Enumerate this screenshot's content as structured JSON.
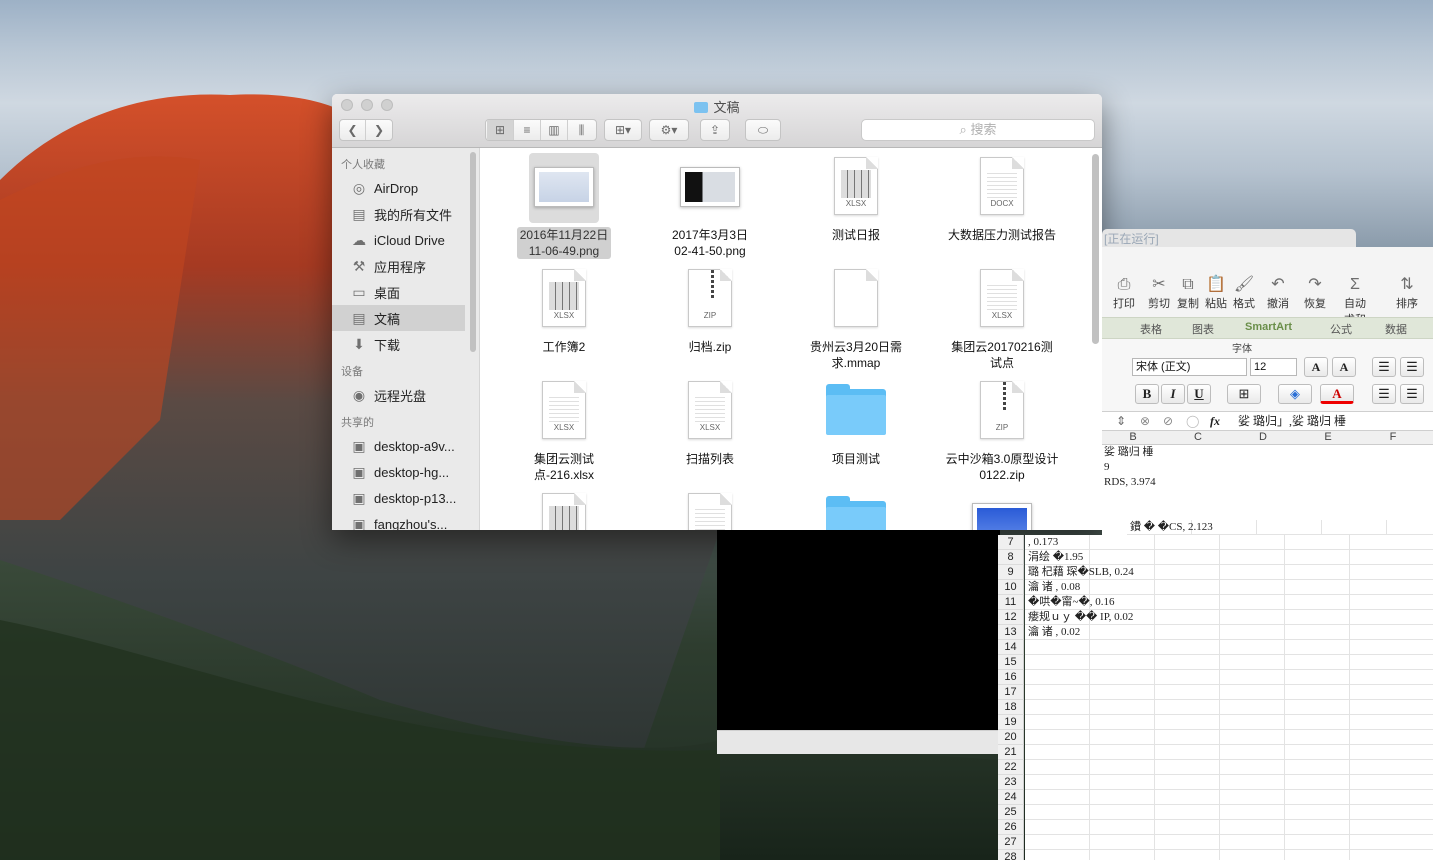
{
  "finder": {
    "title": "文稿",
    "search_placeholder": "搜索",
    "sidebar": {
      "favorites_header": "个人收藏",
      "favorites": [
        {
          "label": "AirDrop",
          "icon": "airdrop-icon"
        },
        {
          "label": "我的所有文件",
          "icon": "all-files-icon"
        },
        {
          "label": "iCloud Drive",
          "icon": "cloud-icon"
        },
        {
          "label": "应用程序",
          "icon": "applications-icon"
        },
        {
          "label": "桌面",
          "icon": "desktop-icon"
        },
        {
          "label": "文稿",
          "icon": "documents-icon",
          "selected": true
        },
        {
          "label": "下载",
          "icon": "downloads-icon"
        }
      ],
      "devices_header": "设备",
      "devices": [
        {
          "label": "远程光盘",
          "icon": "disc-icon"
        }
      ],
      "shared_header": "共享的",
      "shared": [
        {
          "label": "desktop-a9v...",
          "icon": "computer-icon"
        },
        {
          "label": "desktop-hg...",
          "icon": "computer-icon"
        },
        {
          "label": "desktop-p13...",
          "icon": "computer-icon"
        },
        {
          "label": "fangzhou's...",
          "icon": "computer-icon"
        }
      ]
    },
    "files": [
      {
        "line1": "2016年11月22日",
        "line2": "11-06-49.png",
        "kind": "image",
        "selected": true
      },
      {
        "line1": "2017年3月3日",
        "line2": "02-41-50.png",
        "kind": "image"
      },
      {
        "line1": "测试日报",
        "line2": "",
        "kind": "xlsx",
        "tag": "XLSX"
      },
      {
        "line1": "大数据压力测试报告",
        "line2": "",
        "kind": "doc",
        "tag": "DOCX"
      },
      {
        "line1": "工作簿2",
        "line2": "",
        "kind": "xlsx",
        "tag": "XLSX"
      },
      {
        "line1": "归档.zip",
        "line2": "",
        "kind": "zip",
        "tag": "ZIP"
      },
      {
        "line1": "贵州云3月20日需",
        "line2": "求.mmap",
        "kind": "blank"
      },
      {
        "line1": "集团云20170216测",
        "line2": "试点",
        "kind": "doc",
        "tag": "XLSX"
      },
      {
        "line1": "集团云测试",
        "line2": "点-216.xlsx",
        "kind": "doc",
        "tag": "XLSX"
      },
      {
        "line1": "扫描列表",
        "line2": "",
        "kind": "doc",
        "tag": "XLSX"
      },
      {
        "line1": "项目测试",
        "line2": "",
        "kind": "folder"
      },
      {
        "line1": "云中沙箱3.0原型设计",
        "line2": "0122.zip",
        "kind": "zip",
        "tag": "ZIP"
      },
      {
        "line1": "",
        "line2": "",
        "kind": "xlsx"
      },
      {
        "line1": "",
        "line2": "",
        "kind": "doc"
      },
      {
        "line1": "",
        "line2": "",
        "kind": "folder"
      },
      {
        "line1": "",
        "line2": "",
        "kind": "image"
      }
    ]
  },
  "excel": {
    "running_label": "[正在运行]",
    "ribbon_buttons": [
      "打印",
      "剪切",
      "复制",
      "粘贴",
      "格式",
      "撤消",
      "恢复",
      "自动求和",
      "排序"
    ],
    "ribbon_tabs": [
      "表格",
      "图表",
      "SmartArt",
      "公式",
      "数据"
    ],
    "font_group_label": "字体",
    "font_name": "宋体 (正文)",
    "font_size": "12",
    "formula": "娑   璐归」,娑   璐归      棰",
    "fx": "fx",
    "columns": [
      "B",
      "C",
      "D",
      "E",
      "F"
    ],
    "rows": [
      {
        "n": "",
        "text": "娑 璐归    棰"
      },
      {
        "n": "",
        "text": "9"
      },
      {
        "n": "",
        "text": "RDS, 3.974"
      },
      {
        "n": "",
        "text": ""
      },
      {
        "n": "",
        "text": ""
      },
      {
        "n": "",
        "text": "鐨     �    �CS, 2.123"
      },
      {
        "n": "7",
        "text": ", 0.173"
      },
      {
        "n": "8",
        "text": "涓绘   �1.95"
      },
      {
        "n": "9",
        "text": "璐   杞藉     琛�SLB, 0.24"
      },
      {
        "n": "10",
        "text": "瀹   诸   , 0.08"
      },
      {
        "n": "11",
        "text": "�哄�甯~�, 0.16"
      },
      {
        "n": "12",
        "text": "瘘规ｕｙ    ��  IP, 0.02"
      },
      {
        "n": "13",
        "text": "瀹   诸   , 0.02"
      },
      {
        "n": "14",
        "text": ""
      },
      {
        "n": "15",
        "text": ""
      },
      {
        "n": "16",
        "text": ""
      },
      {
        "n": "17",
        "text": ""
      },
      {
        "n": "18",
        "text": ""
      },
      {
        "n": "19",
        "text": ""
      },
      {
        "n": "20",
        "text": ""
      },
      {
        "n": "21",
        "text": ""
      },
      {
        "n": "22",
        "text": ""
      },
      {
        "n": "23",
        "text": ""
      },
      {
        "n": "24",
        "text": ""
      },
      {
        "n": "25",
        "text": ""
      },
      {
        "n": "26",
        "text": ""
      },
      {
        "n": "27",
        "text": ""
      },
      {
        "n": "28",
        "text": ""
      }
    ]
  }
}
